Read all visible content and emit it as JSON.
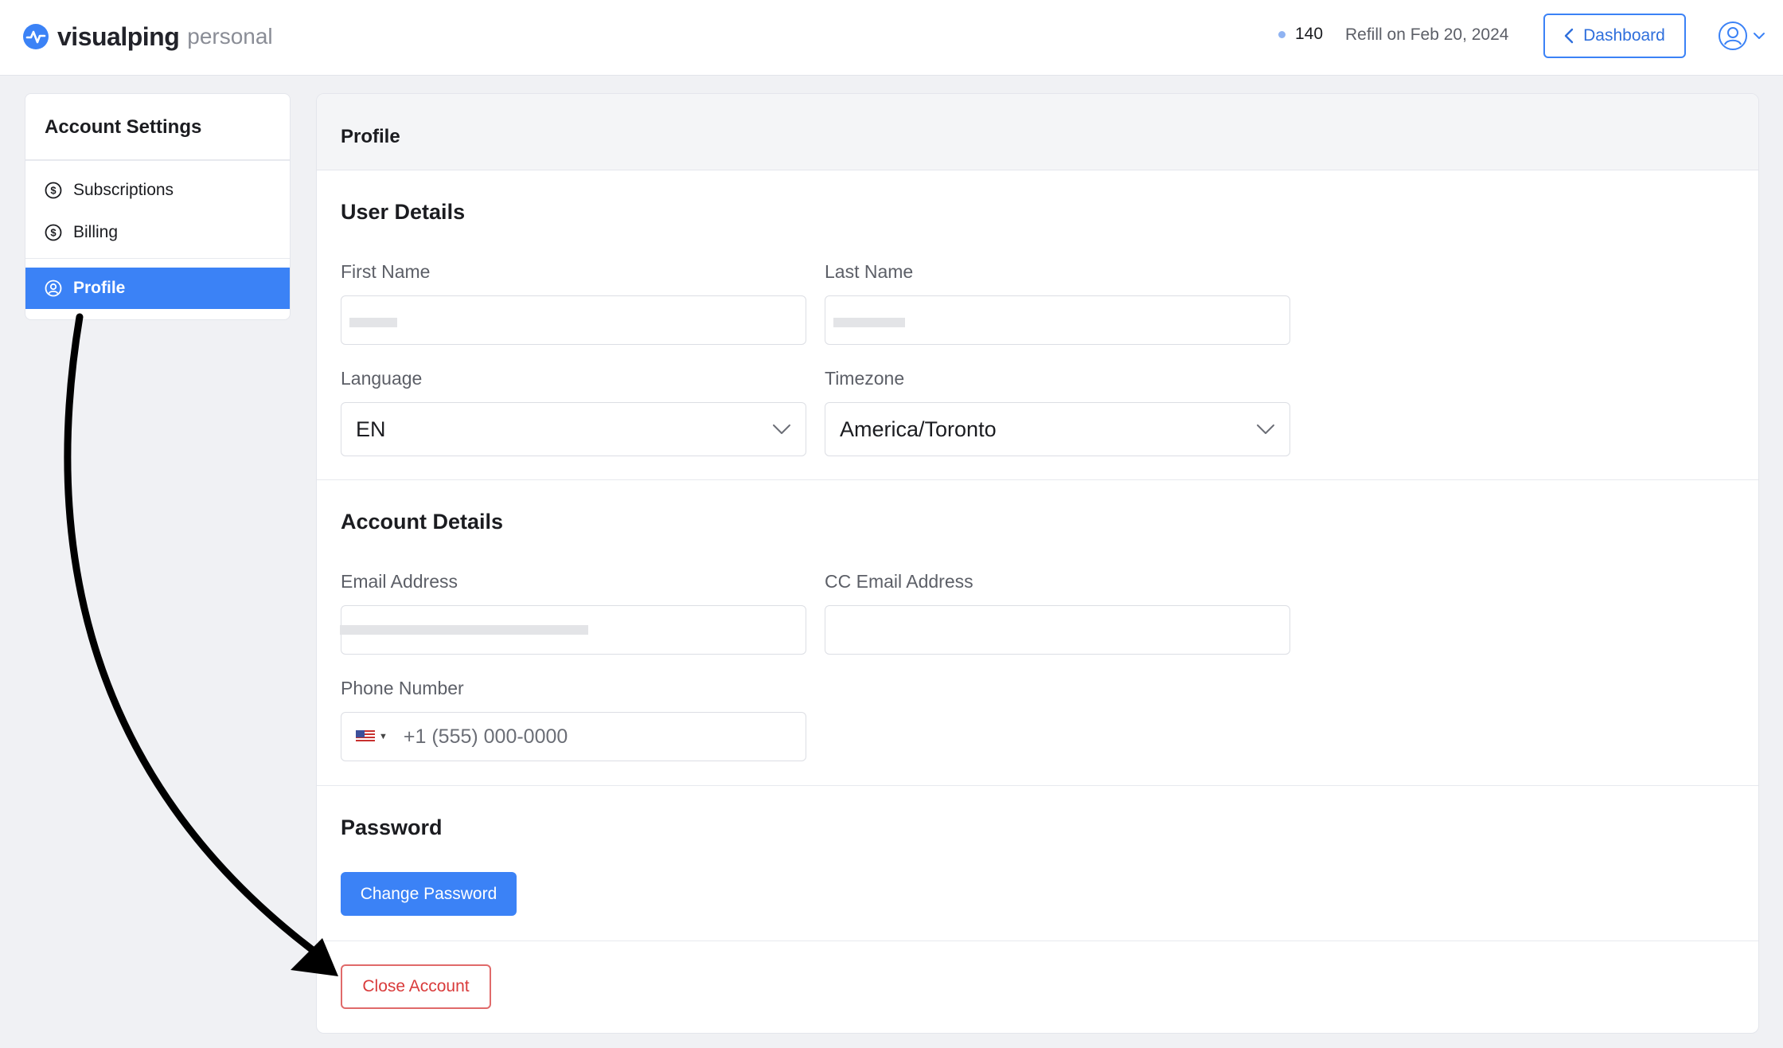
{
  "header": {
    "brand_name": "visualping",
    "plan_label": "personal",
    "credits": "140",
    "refill_text": "Refill on Feb 20, 2024",
    "dashboard_label": "Dashboard"
  },
  "sidebar": {
    "title": "Account Settings",
    "items": [
      {
        "label": "Subscriptions",
        "icon": "dollar-circle-icon"
      },
      {
        "label": "Billing",
        "icon": "dollar-circle-icon"
      },
      {
        "label": "Profile",
        "icon": "user-circle-icon",
        "active": true
      }
    ]
  },
  "main": {
    "header": "Profile",
    "user_details": {
      "title": "User Details",
      "first_name_label": "First Name",
      "last_name_label": "Last Name",
      "language_label": "Language",
      "language_value": "EN",
      "timezone_label": "Timezone",
      "timezone_value": "America/Toronto"
    },
    "account_details": {
      "title": "Account Details",
      "email_label": "Email Address",
      "cc_email_label": "CC Email Address",
      "phone_label": "Phone Number",
      "phone_placeholder": "+1 (555) 000-0000"
    },
    "password": {
      "title": "Password",
      "change_label": "Change Password"
    },
    "close_account_label": "Close Account"
  },
  "colors": {
    "accent": "#3b82f6",
    "danger": "#d93b3b",
    "background": "#f0f1f4"
  }
}
